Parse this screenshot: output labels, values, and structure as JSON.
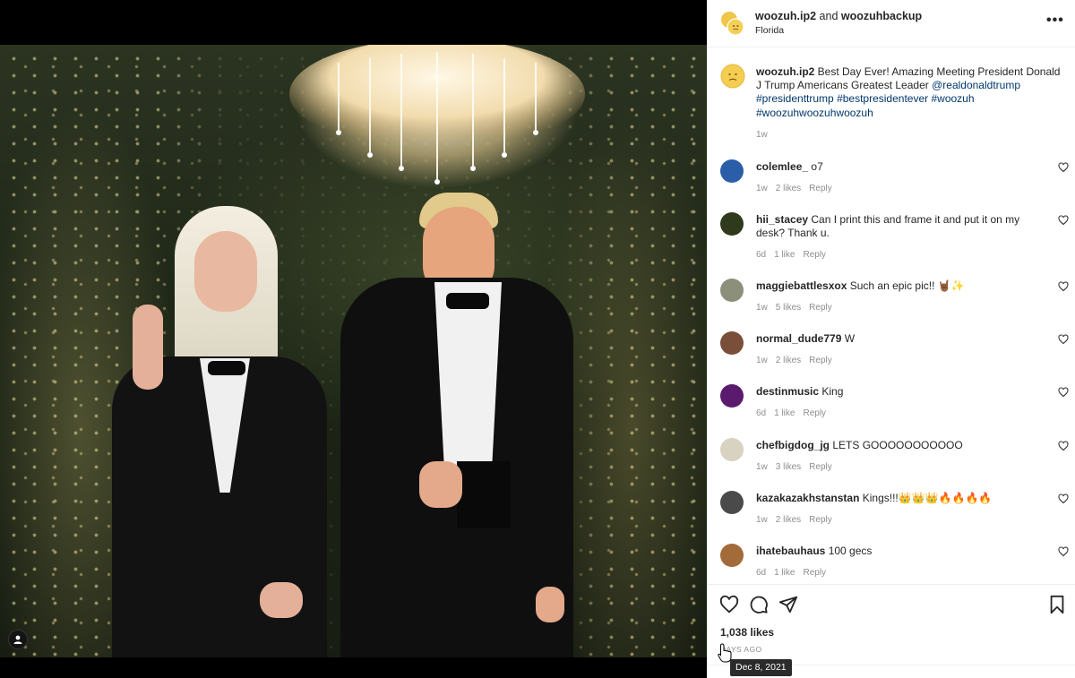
{
  "post": {
    "author": "woozuh.ip2",
    "connector": "and",
    "coauthor": "woozuhbackup",
    "location": "Florida",
    "more_icon": "more-options-icon"
  },
  "caption": {
    "username": "woozuh.ip2",
    "text": "Best Day Ever! Amazing Meeting President Donald J Trump Americans Greatest Leader",
    "mention": "@realdonaldtrump",
    "hashtags": [
      "#presidenttrump",
      "#bestpresidentever",
      "#woozuh",
      "#woozuhwoozuhwoozuh"
    ],
    "time": "1w"
  },
  "comments": [
    {
      "username": "colemlee_",
      "text": "o7",
      "time": "1w",
      "likes": "2 likes",
      "reply": "Reply",
      "avatar_color": "#2a5ea8"
    },
    {
      "username": "hii_stacey",
      "text": "Can I print this and frame it and put it on my desk? Thank u.",
      "time": "6d",
      "likes": "1 like",
      "reply": "Reply",
      "avatar_color": "#2f3a1c"
    },
    {
      "username": "maggiebattlesxox",
      "text": "Such an epic pic!! 🤘🏾✨",
      "time": "1w",
      "likes": "5 likes",
      "reply": "Reply",
      "avatar_color": "#8c8f7a"
    },
    {
      "username": "normal_dude779",
      "text": "W",
      "time": "1w",
      "likes": "2 likes",
      "reply": "Reply",
      "avatar_color": "#7a4f3a"
    },
    {
      "username": "destinmusic",
      "text": "King",
      "time": "6d",
      "likes": "1 like",
      "reply": "Reply",
      "avatar_color": "#5a1a6e"
    },
    {
      "username": "chefbigdog_jg",
      "text": "LETS GOOOOOOOOOOO",
      "time": "1w",
      "likes": "3 likes",
      "reply": "Reply",
      "avatar_color": "#d8d2c0"
    },
    {
      "username": "kazakazakhstanstan",
      "text": "Kings!!!👑👑👑🔥🔥🔥🔥",
      "time": "1w",
      "likes": "2 likes",
      "reply": "Reply",
      "avatar_color": "#4a4a4a"
    },
    {
      "username": "ihatebauhaus",
      "text": "100 gecs",
      "time": "6d",
      "likes": "1 like",
      "reply": "Reply",
      "avatar_color": "#a36a3a"
    }
  ],
  "actions": {
    "like_icon": "heart-icon",
    "comment_icon": "comment-icon",
    "share_icon": "share-icon",
    "save_icon": "bookmark-icon"
  },
  "likes_count": "1,038 likes",
  "posted_ago": "DAYS AGO",
  "tooltip_date": "Dec 8, 2021",
  "colors": {
    "link": "#00376b",
    "secondary": "#8e8e8e",
    "text": "#262626",
    "divider": "#efefef"
  }
}
